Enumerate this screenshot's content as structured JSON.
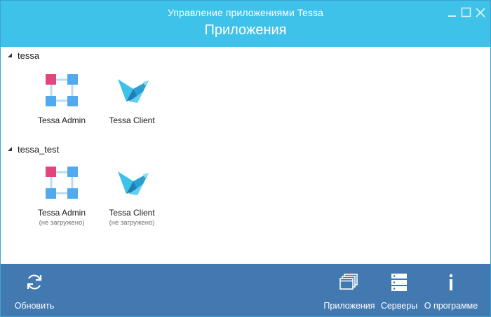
{
  "window": {
    "title": "Управление приложениями Tessa",
    "controls": [
      "minimize-icon",
      "maximize-icon",
      "close-icon"
    ]
  },
  "header": {
    "page_title": "Приложения"
  },
  "groups": [
    {
      "name": "tessa",
      "apps": [
        {
          "label": "Tessa Admin",
          "status": "",
          "icon": "tessa-admin-icon"
        },
        {
          "label": "Tessa Client",
          "status": "",
          "icon": "tessa-client-icon"
        }
      ]
    },
    {
      "name": "tessa_test",
      "apps": [
        {
          "label": "Tessa Admin",
          "status": "(не загружено)",
          "icon": "tessa-admin-icon"
        },
        {
          "label": "Tessa Client",
          "status": "(не загружено)",
          "icon": "tessa-client-icon"
        }
      ]
    }
  ],
  "toolbar": {
    "refresh_label": "Обновить",
    "applications_label": "Приложения",
    "servers_label": "Серверы",
    "about_label": "О программе"
  },
  "colors": {
    "titlebar": "#3ec2ea",
    "bottombar": "#4279b1",
    "admin_accent": "#e2457d",
    "admin_node": "#52a9ee"
  }
}
